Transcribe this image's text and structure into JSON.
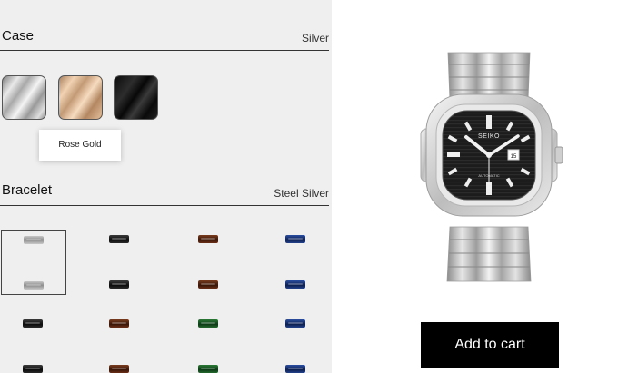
{
  "case": {
    "title": "Case",
    "selected_value": "Silver",
    "swatches": [
      {
        "name": "Silver"
      },
      {
        "name": "Rose Gold"
      },
      {
        "name": "Black"
      }
    ],
    "tooltip": "Rose Gold"
  },
  "bracelet": {
    "title": "Bracelet",
    "selected_value": "Steel Silver"
  },
  "product": {
    "dial_brand": "SEIKO",
    "dial_text": "AUTOMATIC"
  },
  "cart": {
    "add_label": "Add to cart"
  },
  "colors": {
    "panel_bg": "#efefef",
    "button_bg": "#000000",
    "button_text": "#ffffff",
    "dial": "#1a1a1a"
  }
}
